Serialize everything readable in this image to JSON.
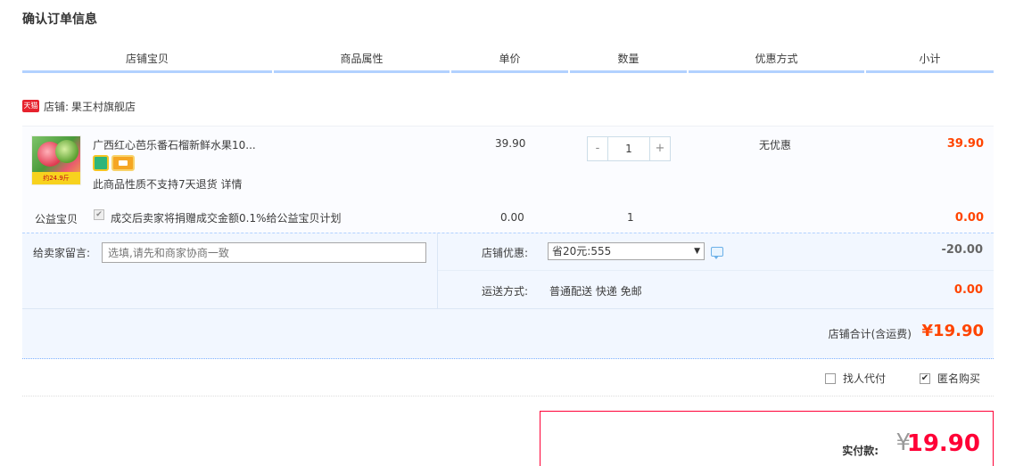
{
  "page": {
    "title": "确认订单信息"
  },
  "columns": [
    "店铺宝贝",
    "商品属性",
    "单价",
    "数量",
    "优惠方式",
    "小计"
  ],
  "shop": {
    "badge": "天猫",
    "label": "店铺:",
    "name": "果王村旗舰店"
  },
  "item": {
    "title": "广西红心芭乐番石榴新鲜水果10...",
    "thumb_tag": "约24.9斤",
    "refund_note": "此商品性质不支持7天退货 详情",
    "unit_price": "39.90",
    "quantity": "1",
    "qty_minus": "-",
    "qty_plus": "+",
    "discount": "无优惠",
    "subtotal": "39.90"
  },
  "charity": {
    "label": "公益宝贝",
    "text": "成交后卖家将捐赠成交金额0.1%给公益宝贝计划",
    "price": "0.00",
    "qty": "1",
    "subtotal": "0.00"
  },
  "message": {
    "label": "给卖家留言:",
    "placeholder": "选填,请先和商家协商一致"
  },
  "coupon": {
    "label": "店铺优惠:",
    "selected": "省20元:555",
    "amount": "-20.00"
  },
  "shipping": {
    "label": "运送方式:",
    "value": "普通配送 快递 免邮",
    "fee": "0.00"
  },
  "shop_total": {
    "label": "店铺合计(含运费)",
    "value": "¥19.90"
  },
  "options": {
    "proxy_pay": "找人代付",
    "anonymous": "匿名购买"
  },
  "payment": {
    "label": "实付款:",
    "currency": "¥",
    "amount": "19.90"
  },
  "colors": {
    "price_red": "#ff4400",
    "accent_blue": "#b2d1ff",
    "pay_red": "#ff0036"
  }
}
